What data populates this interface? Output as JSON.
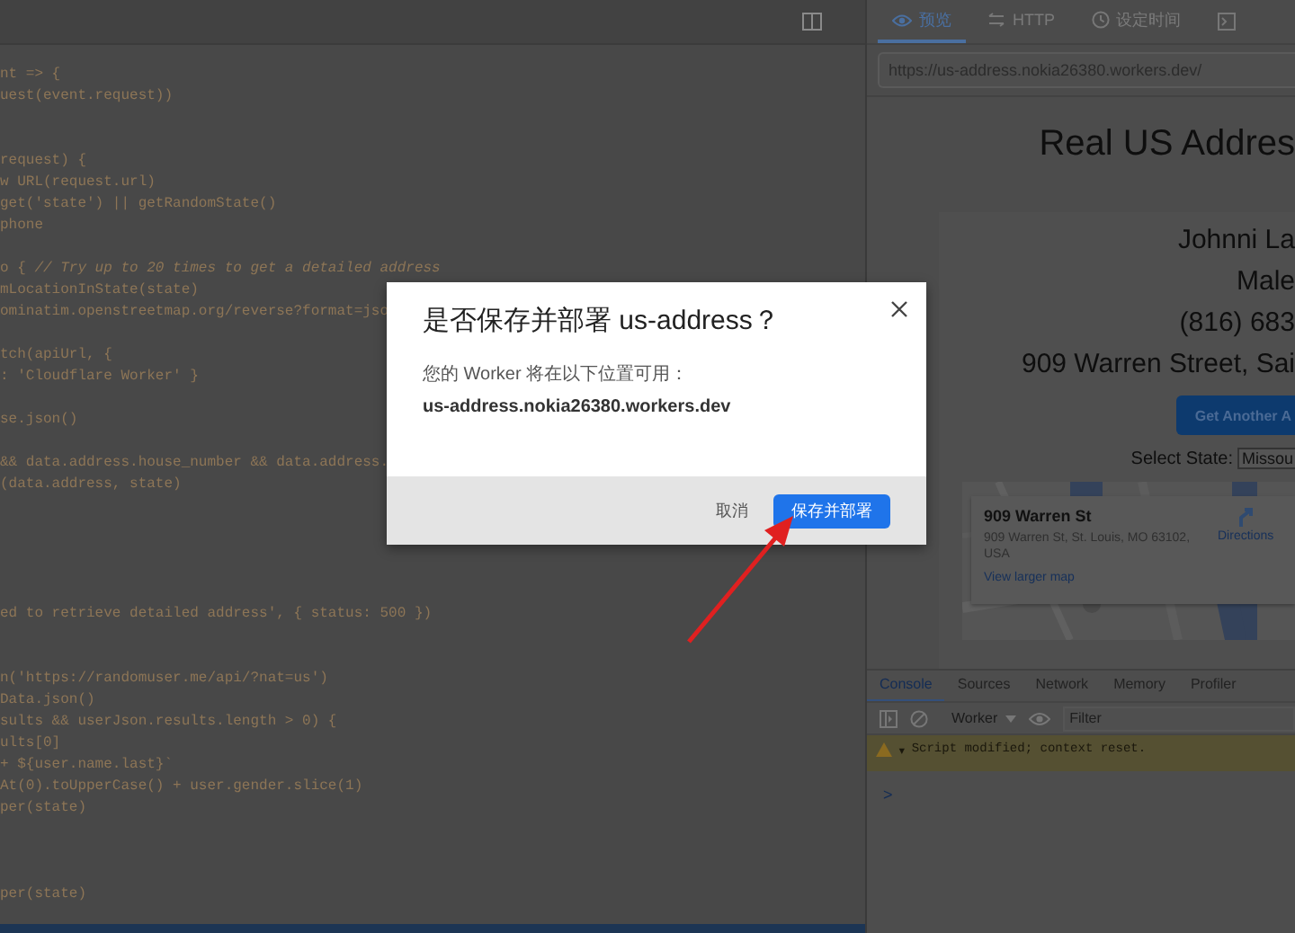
{
  "editor": {
    "lines": [
      {
        "kind": "code",
        "text": "nt => {"
      },
      {
        "kind": "code",
        "text": "uest(event.request))"
      },
      {
        "kind": "blank"
      },
      {
        "kind": "blank"
      },
      {
        "kind": "code",
        "text": "request) {"
      },
      {
        "kind": "code",
        "text": "w URL(request.url)"
      },
      {
        "kind": "code",
        "text": "get('state') || getRandomState()"
      },
      {
        "kind": "code",
        "text": "phone"
      },
      {
        "kind": "blank"
      },
      {
        "kind": "code",
        "text": "o { *// Try up to 20 times to get a detailed address*"
      },
      {
        "kind": "code",
        "text": "mLocationInState(state)"
      },
      {
        "kind": "code",
        "text": "ominatim.openstreetmap.org/reverse?format=jso"
      },
      {
        "kind": "blank"
      },
      {
        "kind": "code",
        "text": "tch(apiUrl, {"
      },
      {
        "kind": "code",
        "text": ": 'Cloudflare Worker' }"
      },
      {
        "kind": "blank"
      },
      {
        "kind": "code",
        "text": "se.json()"
      },
      {
        "kind": "blank"
      },
      {
        "kind": "code",
        "text": "&& data.address.house_number && data.address."
      },
      {
        "kind": "code",
        "text": "(data.address, state)"
      },
      {
        "kind": "blank"
      },
      {
        "kind": "blank"
      },
      {
        "kind": "blank"
      },
      {
        "kind": "blank"
      },
      {
        "kind": "blank"
      },
      {
        "kind": "code",
        "text": "ed to retrieve detailed address', { status: 500 })"
      },
      {
        "kind": "blank"
      },
      {
        "kind": "blank"
      },
      {
        "kind": "code",
        "text": "n('https://randomuser.me/api/?nat=us')"
      },
      {
        "kind": "code",
        "text": "Data.json()"
      },
      {
        "kind": "code",
        "text": "sults && userJson.results.length > 0) {"
      },
      {
        "kind": "code",
        "text": "ults[0]"
      },
      {
        "kind": "code",
        "text": "+ ${user.name.last}`"
      },
      {
        "kind": "code",
        "text": "At(0).toUpperCase() + user.gender.slice(1)"
      },
      {
        "kind": "code",
        "text": "per(state)"
      },
      {
        "kind": "blank"
      },
      {
        "kind": "blank"
      },
      {
        "kind": "blank"
      },
      {
        "kind": "code",
        "text": "per(state)"
      }
    ]
  },
  "preview_tabs": [
    {
      "label": "预览",
      "kind": "eye",
      "selected": true
    },
    {
      "label": "HTTP",
      "kind": "swap",
      "selected": false
    },
    {
      "label": "设定时间",
      "kind": "clock",
      "selected": false
    }
  ],
  "url": "https://us-address.nokia26380.workers.dev/",
  "page": {
    "title": "Real US Addres",
    "name": "Johnni La",
    "gender": "Male",
    "phone": "(816) 683",
    "address": "909 Warren Street, Sai",
    "button": "Get Another A",
    "state_label": "Select State:",
    "state_value": "Missou",
    "map_card": {
      "title": "909 Warren St",
      "address": "909 Warren St, St. Louis, MO 63102, USA",
      "directions": "Directions",
      "link": "View larger map"
    }
  },
  "devtools": {
    "tabs": [
      {
        "label": "Console",
        "selected": true
      },
      {
        "label": "Sources",
        "selected": false
      },
      {
        "label": "Network",
        "selected": false
      },
      {
        "label": "Memory",
        "selected": false
      },
      {
        "label": "Profiler",
        "selected": false
      }
    ],
    "context": "Worker",
    "filter_placeholder": "Filter",
    "messages": [
      {
        "kind": "warning",
        "glyph": "▾",
        "text": "Script modified; context reset."
      }
    ],
    "prompt": ">"
  },
  "dialog": {
    "title": "是否保存并部署 us-address？",
    "body": "您的 Worker 将在以下位置可用：",
    "url": "us-address.nokia26380.workers.dev",
    "cancel": "取消",
    "confirm": "保存并部署"
  }
}
